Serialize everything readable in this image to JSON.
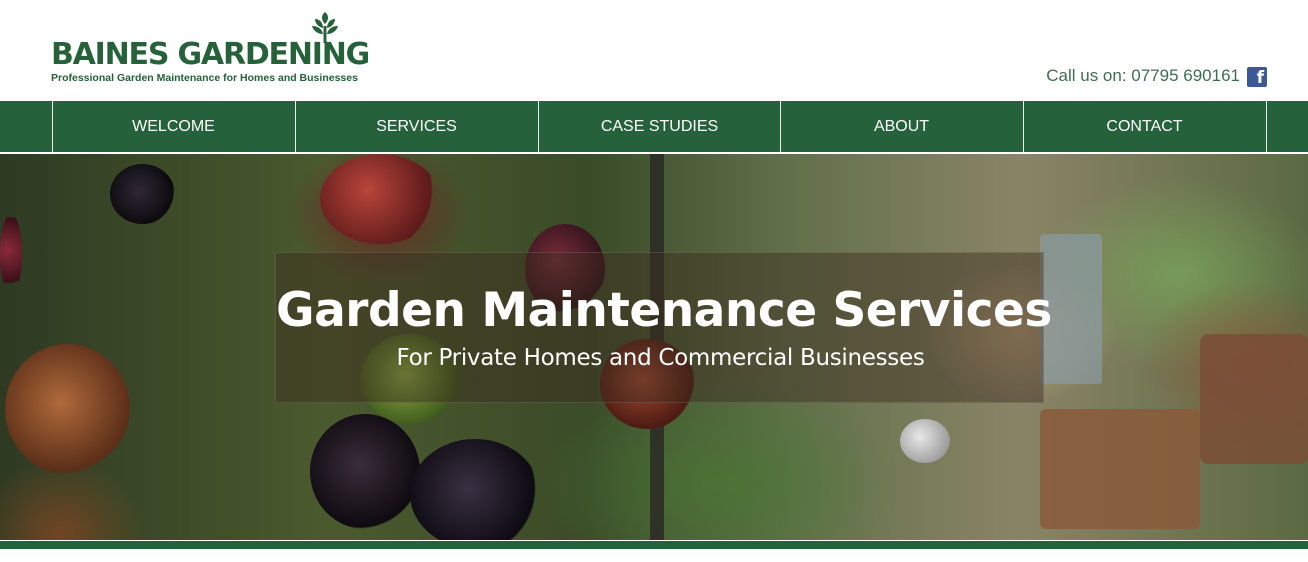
{
  "brand": {
    "name": "BAINES GARDENING",
    "tagline": "Professional Garden Maintenance for Homes and Businesses",
    "color": "#256139",
    "logo_icon": "sprout-icon"
  },
  "contact": {
    "call_text": "Call us on: 07795 690161",
    "social_icon": "facebook-icon"
  },
  "nav": {
    "items": [
      {
        "label": "WELCOME"
      },
      {
        "label": "SERVICES"
      },
      {
        "label": "CASE STUDIES"
      },
      {
        "label": "ABOUT"
      },
      {
        "label": "CONTACT"
      }
    ],
    "background": "#25613a"
  },
  "hero": {
    "title": "Garden Maintenance Services",
    "subtitle": "For Private Homes and Commercial Businesses"
  }
}
